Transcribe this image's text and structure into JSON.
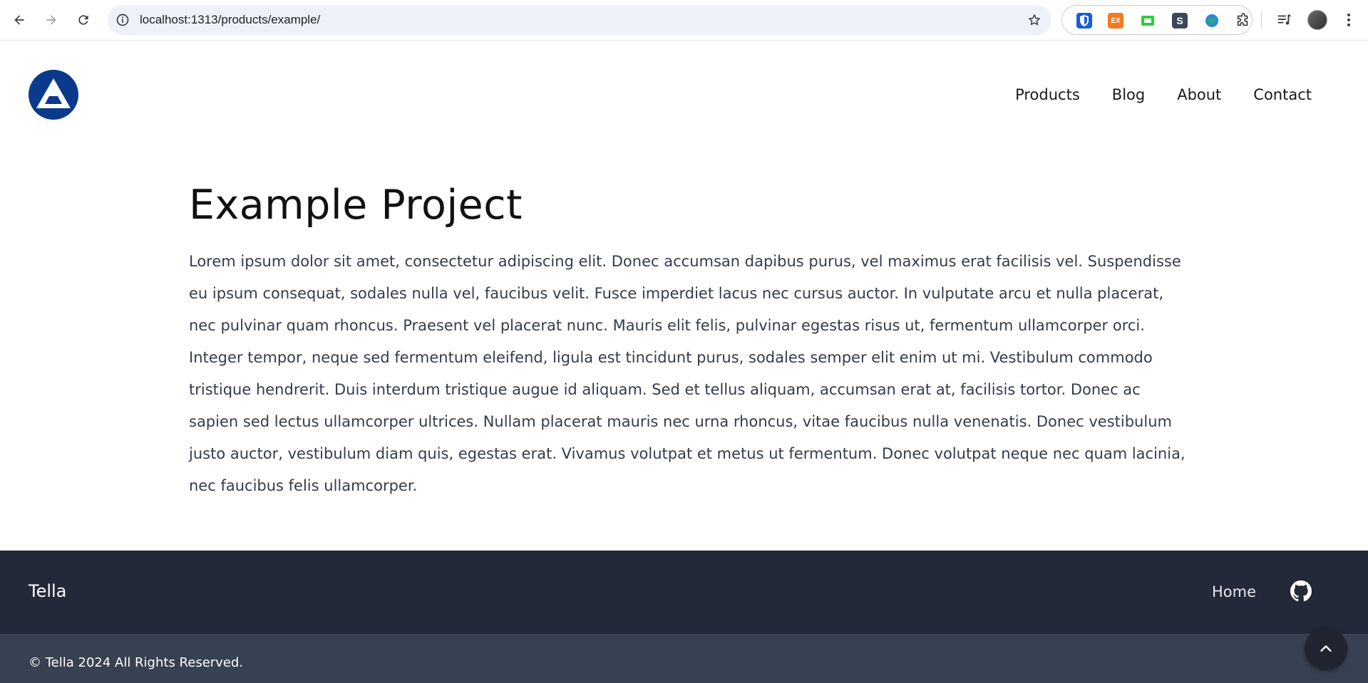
{
  "browser": {
    "url": "localhost:1313/products/example/",
    "extensions": [
      {
        "name": "bitwarden-icon",
        "color": "#175ddc",
        "label": ""
      },
      {
        "name": "ex-extension-icon",
        "color": "#f47a20",
        "label": "EX"
      },
      {
        "name": "green-extension-icon",
        "color": "#2ecc40",
        "label": ""
      },
      {
        "name": "s-extension-icon",
        "color": "#3c4858",
        "label": "S"
      },
      {
        "name": "globe-extension-icon",
        "color": "#2e86de",
        "label": ""
      }
    ]
  },
  "site": {
    "brand_color": "#0a3a8c",
    "nav": [
      "Products",
      "Blog",
      "About",
      "Contact"
    ]
  },
  "content": {
    "title": "Example Project",
    "body": "Lorem ipsum dolor sit amet, consectetur adipiscing elit. Donec accumsan dapibus purus, vel maximus erat facilisis vel. Suspendisse eu ipsum consequat, sodales nulla vel, faucibus velit. Fusce imperdiet lacus nec cursus auctor. In vulputate arcu et nulla placerat, nec pulvinar quam rhoncus. Praesent vel placerat nunc. Mauris elit felis, pulvinar egestas risus ut, fermentum ullamcorper orci. Integer tempor, neque sed fermentum eleifend, ligula est tincidunt purus, sodales semper elit enim ut mi. Vestibulum commodo tristique hendrerit. Duis interdum tristique augue id aliquam. Sed et tellus aliquam, accumsan erat at, facilisis tortor. Donec ac sapien sed lectus ullamcorper ultrices. Nullam placerat mauris nec urna rhoncus, vitae faucibus nulla venenatis. Donec vestibulum justo auctor, vestibulum diam quis, egestas erat. Vivamus volutpat et metus ut fermentum. Donec volutpat neque nec quam lacinia, nec faucibus felis ullamcorper."
  },
  "footer": {
    "brand": "Tella",
    "home_link": "Home",
    "copyright": "© Tella 2024 All Rights Reserved.",
    "colors": {
      "main": "#222938",
      "bottom": "#374151"
    }
  }
}
